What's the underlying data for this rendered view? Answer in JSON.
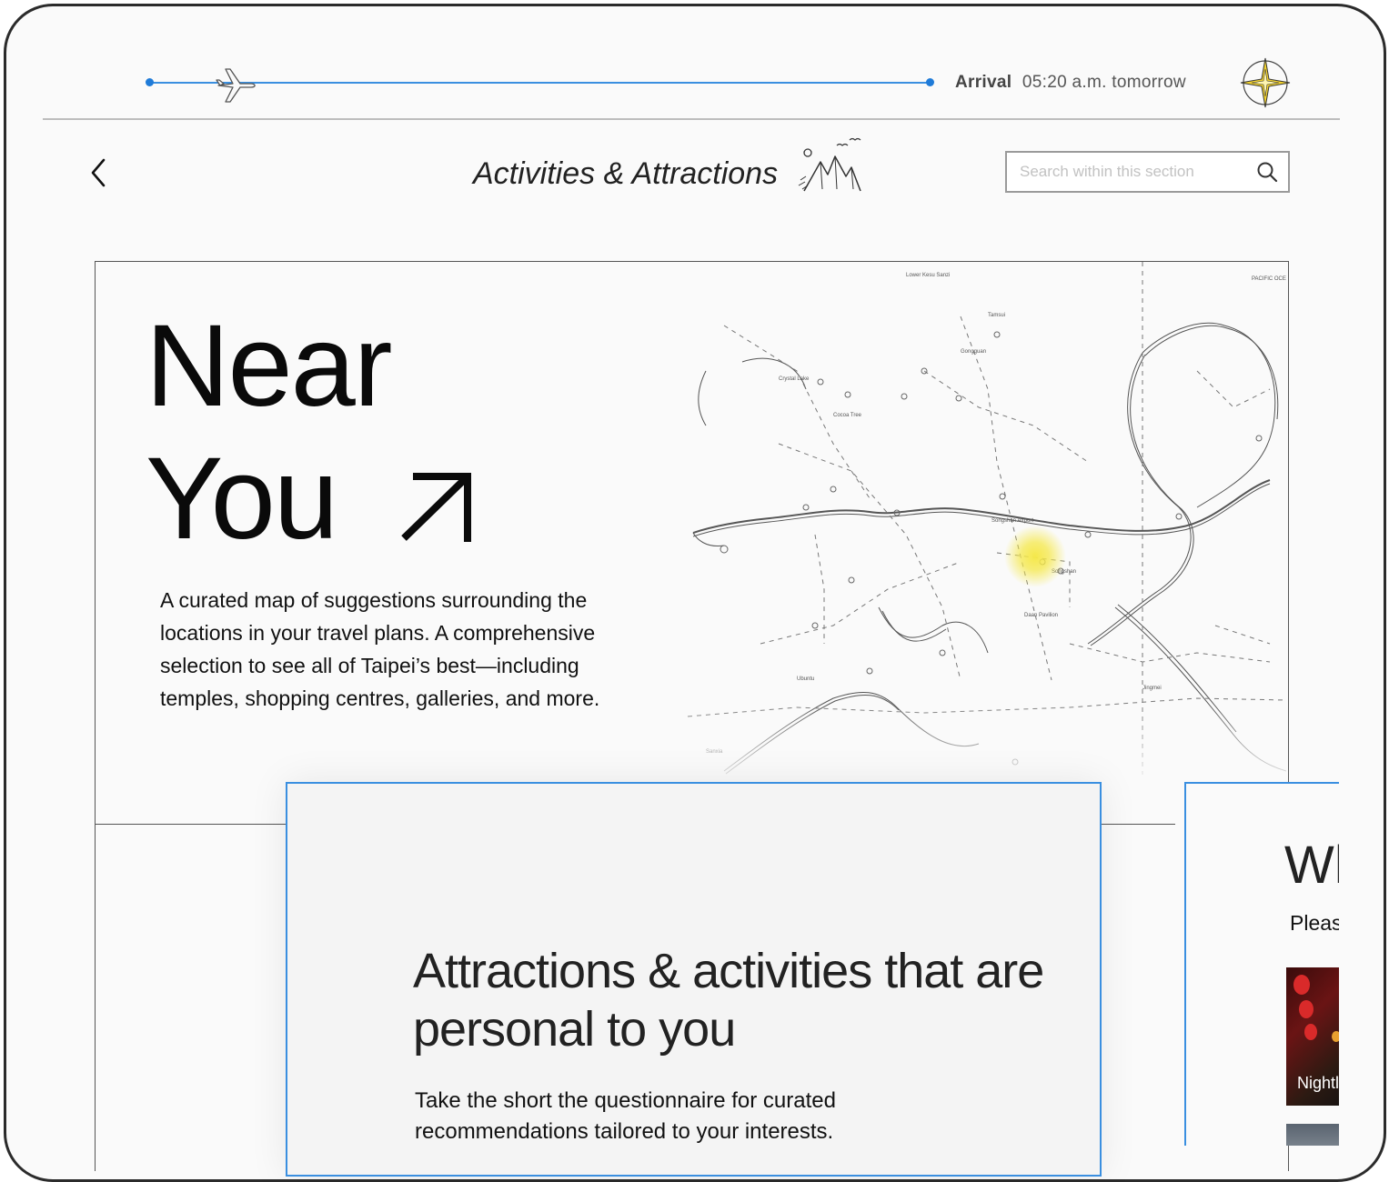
{
  "flight": {
    "arrival_label": "Arrival",
    "arrival_time": "05:20 a.m. tomorrow"
  },
  "header": {
    "title": "Activities & Attractions",
    "search_placeholder": "Search within this section"
  },
  "near_you": {
    "title_line1": "Near",
    "title_line2": "You",
    "description": "A curated map of suggestions surrounding the locations in your travel plans. A comprehensive selection to see all of Taipei’s best—including temples, shopping centres, galleries, and more."
  },
  "personal": {
    "title": "Attractions & activities that are personal to you",
    "description": "Take the short the questionnaire for curated recommendations tailored to your interests."
  },
  "peek": {
    "title": "Wh",
    "subtitle": "Pleas",
    "thumb_label": "Nightl"
  },
  "colors": {
    "accent": "#3a8fe0",
    "compass_star": "#f2d22e",
    "highlight": "#f5e84a"
  }
}
